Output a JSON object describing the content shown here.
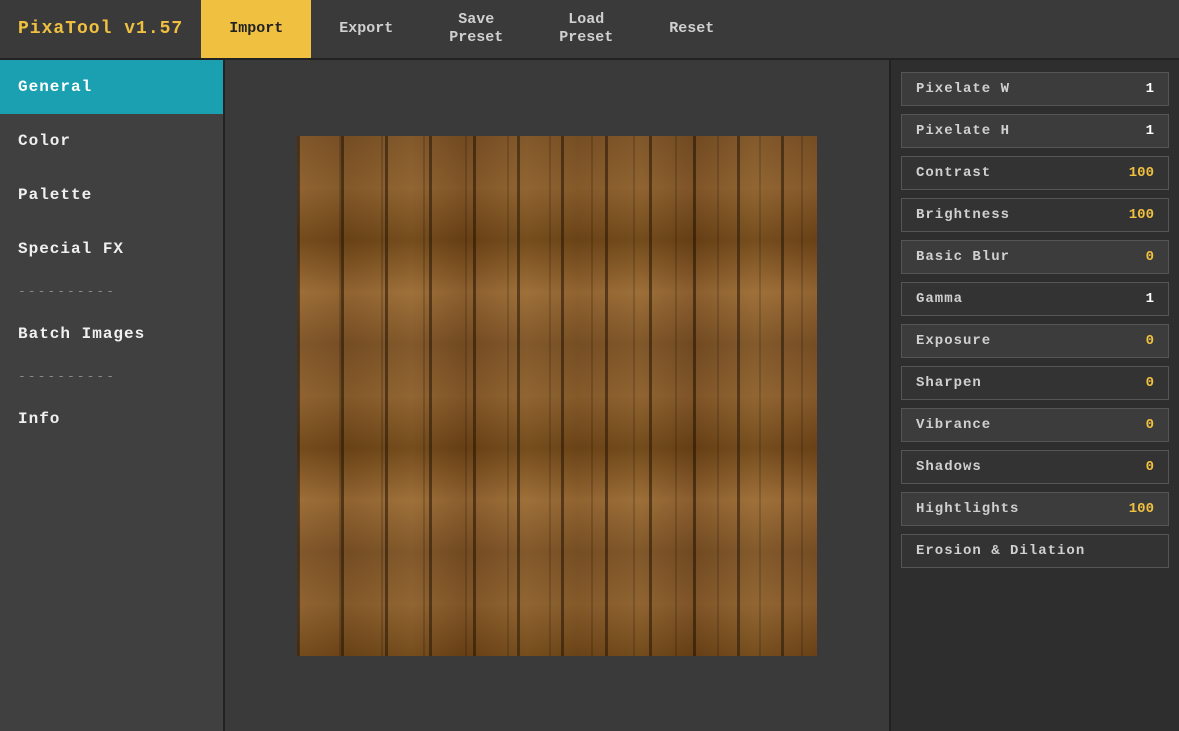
{
  "app": {
    "title": "PixaTool v1.57"
  },
  "nav": {
    "brand": "PixaTool v1.57",
    "buttons": [
      {
        "id": "import",
        "label": "Import",
        "active": true
      },
      {
        "id": "export",
        "label": "Export",
        "active": false
      },
      {
        "id": "save-preset",
        "label": "Save\nPreset",
        "active": false
      },
      {
        "id": "load-preset",
        "label": "Load\nPreset",
        "active": false
      },
      {
        "id": "reset",
        "label": "Reset",
        "active": false
      }
    ]
  },
  "sidebar": {
    "items": [
      {
        "id": "general",
        "label": "General",
        "active": true
      },
      {
        "id": "color",
        "label": "Color",
        "active": false
      },
      {
        "id": "palette",
        "label": "Palette",
        "active": false
      },
      {
        "id": "special-fx",
        "label": "Special FX",
        "active": false
      },
      {
        "id": "divider1",
        "label": "----------",
        "divider": true
      },
      {
        "id": "batch-images",
        "label": "Batch Images",
        "active": false
      },
      {
        "id": "divider2",
        "label": "----------",
        "divider": true
      },
      {
        "id": "info",
        "label": "Info",
        "active": false
      }
    ]
  },
  "controls": [
    {
      "id": "pixelate-w",
      "label": "Pixelate W",
      "value": "1",
      "value_color": "white"
    },
    {
      "id": "pixelate-h",
      "label": "Pixelate H",
      "value": "1",
      "value_color": "white"
    },
    {
      "id": "contrast",
      "label": "Contrast",
      "value": "100",
      "value_color": "yellow"
    },
    {
      "id": "brightness",
      "label": "Brightness",
      "value": "100",
      "value_color": "yellow"
    },
    {
      "id": "basic-blur",
      "label": "Basic Blur",
      "value": "0",
      "value_color": "yellow"
    },
    {
      "id": "gamma",
      "label": "Gamma",
      "value": "1",
      "value_color": "white"
    },
    {
      "id": "exposure",
      "label": "Exposure",
      "value": "0",
      "value_color": "yellow"
    },
    {
      "id": "sharpen",
      "label": "Sharpen",
      "value": "0",
      "value_color": "yellow"
    },
    {
      "id": "vibrance",
      "label": "Vibrance",
      "value": "0",
      "value_color": "yellow"
    },
    {
      "id": "shadows",
      "label": "Shadows",
      "value": "0",
      "value_color": "yellow"
    },
    {
      "id": "highlights",
      "label": "Hightlights",
      "value": "100",
      "value_color": "yellow"
    },
    {
      "id": "erosion-dilation",
      "label": "Erosion & Dilation",
      "value": "",
      "value_color": "yellow"
    }
  ]
}
